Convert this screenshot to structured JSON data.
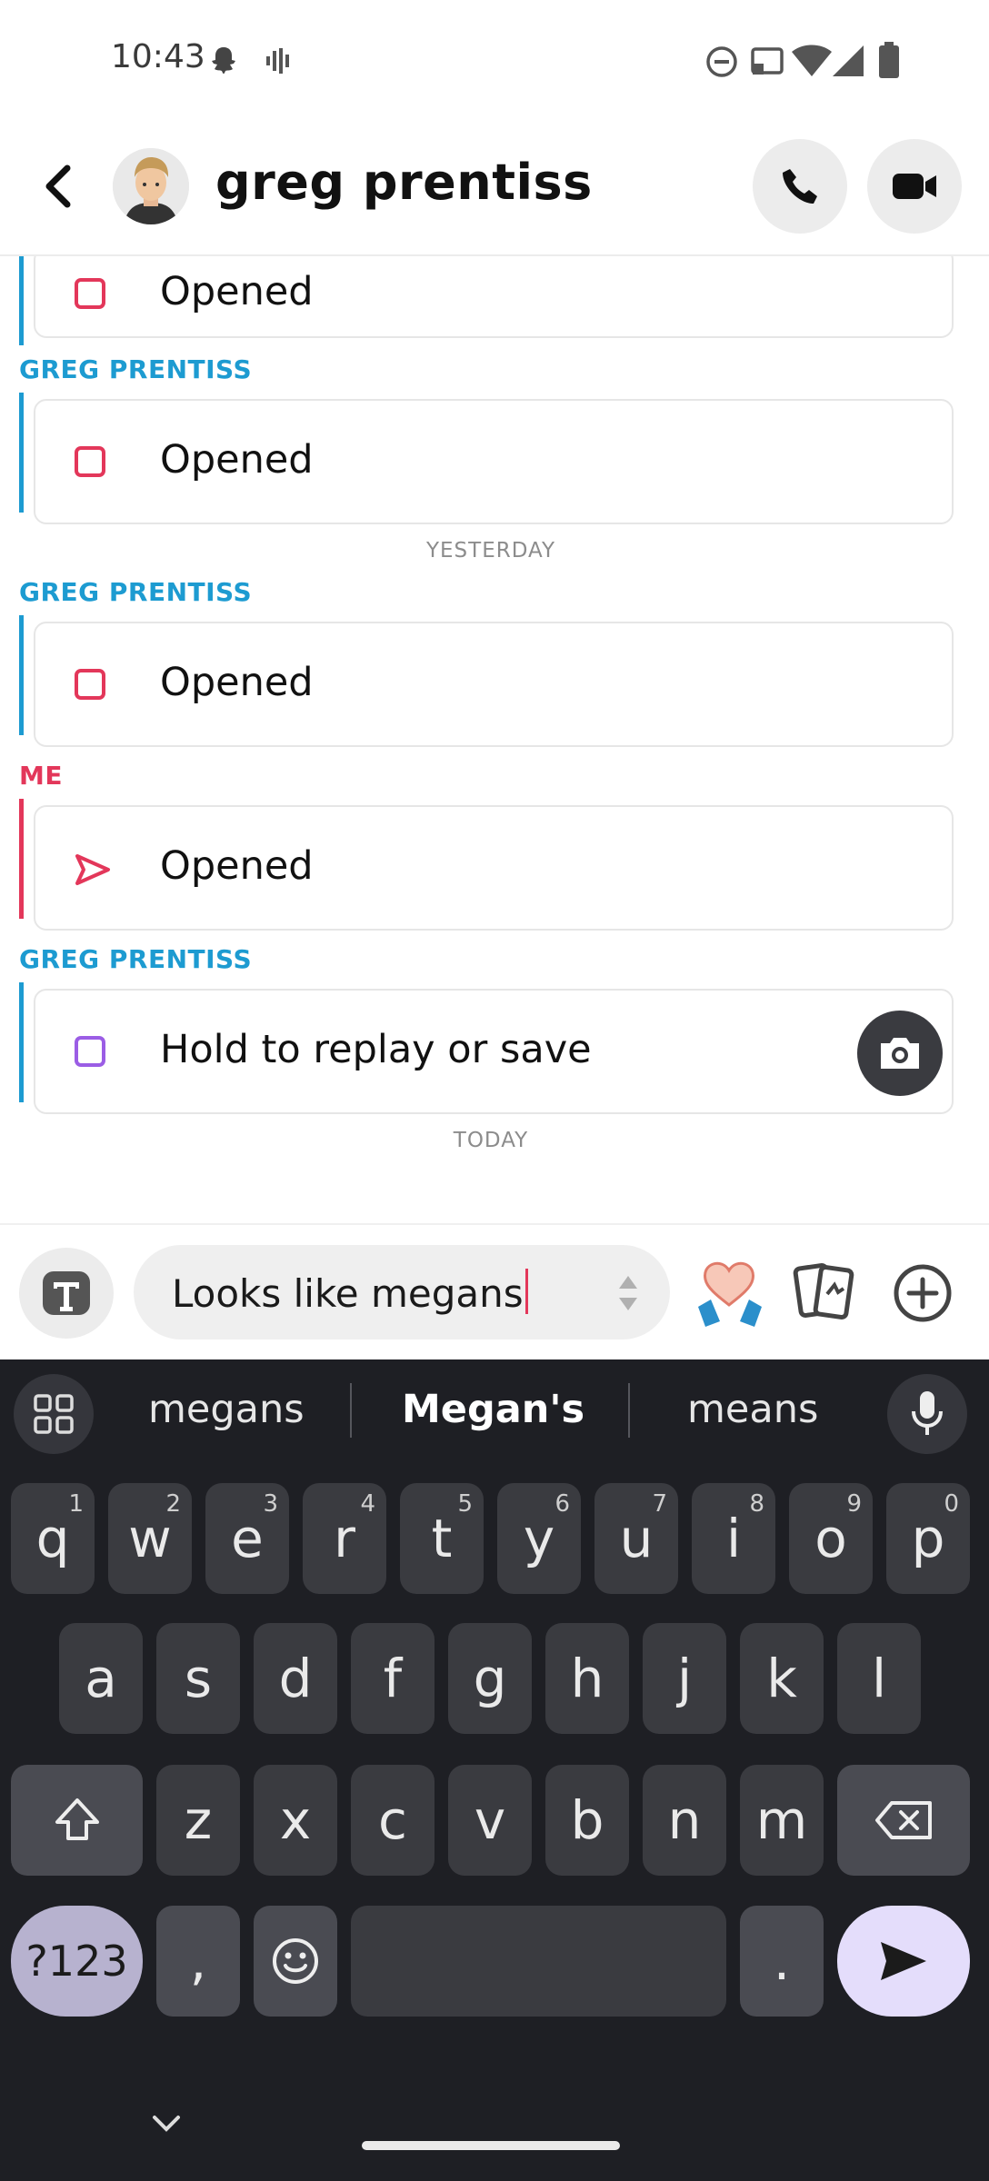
{
  "status_bar": {
    "time": "10:43"
  },
  "header": {
    "contact_name": "greg prentiss"
  },
  "messages": [
    {
      "sender": "",
      "text": "Opened"
    },
    {
      "sender": "GREG PRENTISS",
      "text": "Opened"
    },
    {
      "separator": "YESTERDAY"
    },
    {
      "sender": "GREG PRENTISS",
      "text": "Opened"
    },
    {
      "sender": "ME",
      "text": "Opened"
    },
    {
      "sender": "GREG PRENTISS",
      "text": "Hold to replay or save"
    },
    {
      "separator": "TODAY"
    }
  ],
  "input": {
    "value": "Looks like megans"
  },
  "keyboard": {
    "suggestions": [
      "megans",
      "Megan's",
      "means"
    ],
    "row1": [
      [
        "q",
        "1"
      ],
      [
        "w",
        "2"
      ],
      [
        "e",
        "3"
      ],
      [
        "r",
        "4"
      ],
      [
        "t",
        "5"
      ],
      [
        "y",
        "6"
      ],
      [
        "u",
        "7"
      ],
      [
        "i",
        "8"
      ],
      [
        "o",
        "9"
      ],
      [
        "p",
        "0"
      ]
    ],
    "row2": [
      "a",
      "s",
      "d",
      "f",
      "g",
      "h",
      "j",
      "k",
      "l"
    ],
    "row3": [
      "z",
      "x",
      "c",
      "v",
      "b",
      "n",
      "m"
    ],
    "row4": {
      "symbols": "?123",
      "comma": ",",
      "period": "."
    }
  },
  "colors": {
    "greg": "#1d9bd1",
    "me": "#e3375a",
    "unread_snap": "#9b5de5"
  }
}
